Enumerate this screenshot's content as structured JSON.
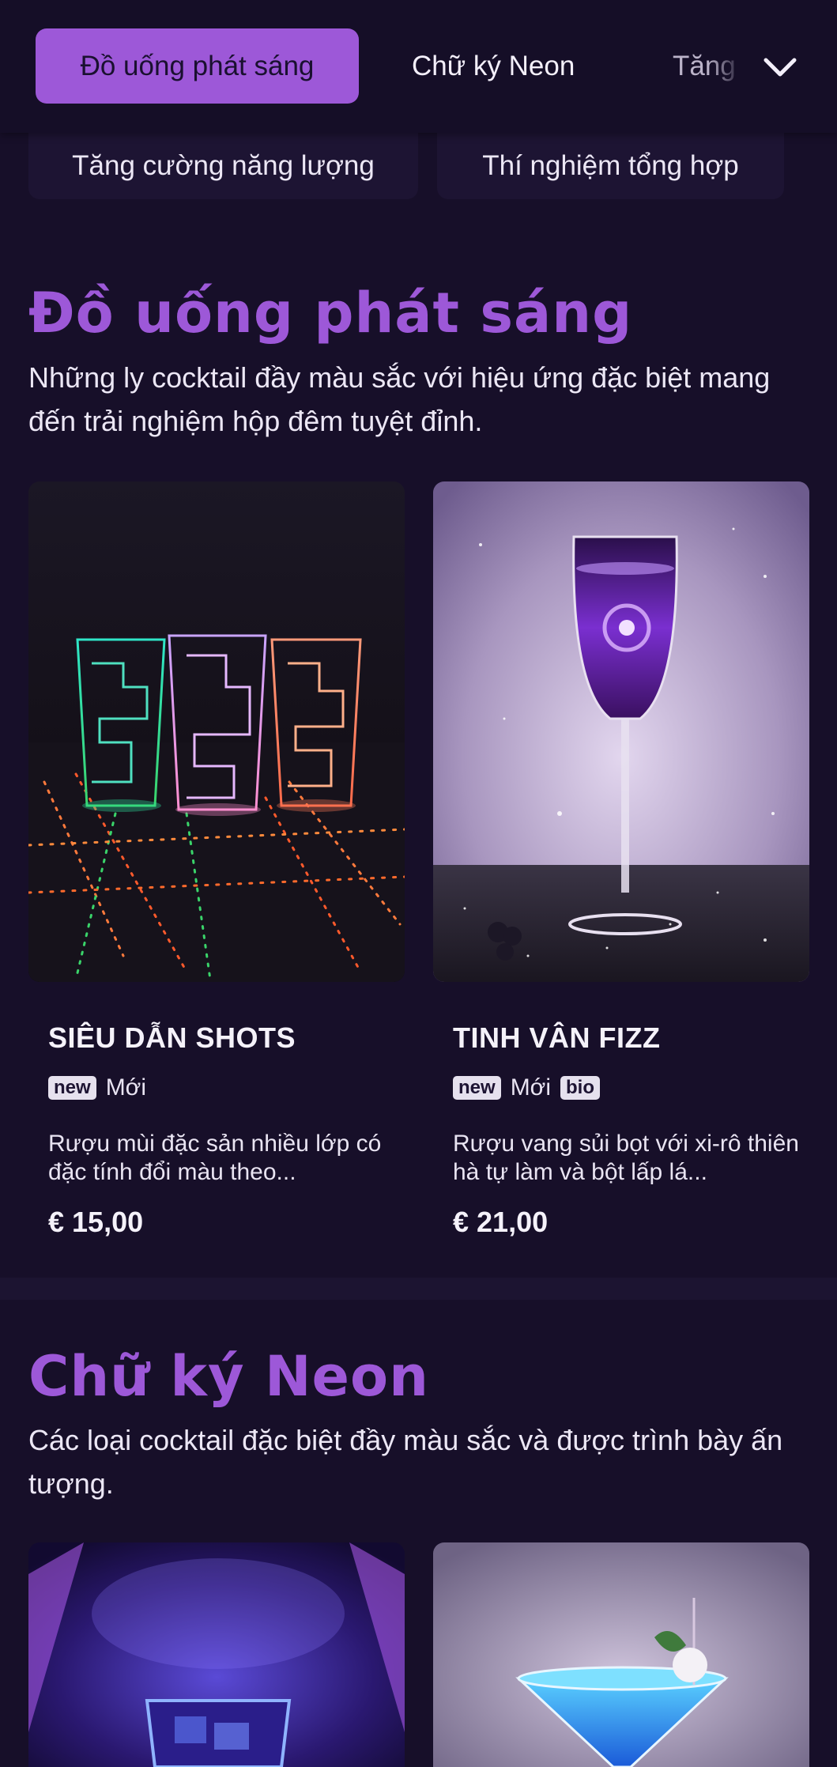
{
  "nav": {
    "tabs": [
      {
        "label": "Đồ uống phát sáng",
        "active": true
      },
      {
        "label": "Chữ ký Neon",
        "active": false
      },
      {
        "label": "Tăng",
        "active": false
      }
    ],
    "subtabs": [
      "Tăng cường năng lượng",
      "Thí nghiệm tổng hợp"
    ],
    "more_icon": "chevron-down-icon"
  },
  "sections": [
    {
      "title": "Đồ uống phát sáng",
      "description": "Những ly cocktail đầy màu sắc với hiệu ứng đặc biệt mang đến trải nghiệm hộp đêm tuyệt đỉnh.",
      "items": [
        {
          "name": "SIÊU DẪN SHOTS",
          "tags": [
            "new"
          ],
          "status": "Mới",
          "description": "Rượu mùi đặc sản nhiều lớp có đặc tính đổi màu theo...",
          "price": "€ 15,00"
        },
        {
          "name": "TINH VÂN FIZZ",
          "tags": [
            "new",
            "bio"
          ],
          "status": "Mới",
          "description": "Rượu vang sủi bọt với xi-rô thiên hà tự làm và bột lấp lá...",
          "price": "€ 21,00"
        }
      ]
    },
    {
      "title": "Chữ ký Neon",
      "description": "Các loại cocktail đặc biệt đầy màu sắc và được trình bày ấn tượng."
    }
  ],
  "colors": {
    "background": "#170f29",
    "accent": "#9d58d8",
    "text": "#ece7f5"
  }
}
